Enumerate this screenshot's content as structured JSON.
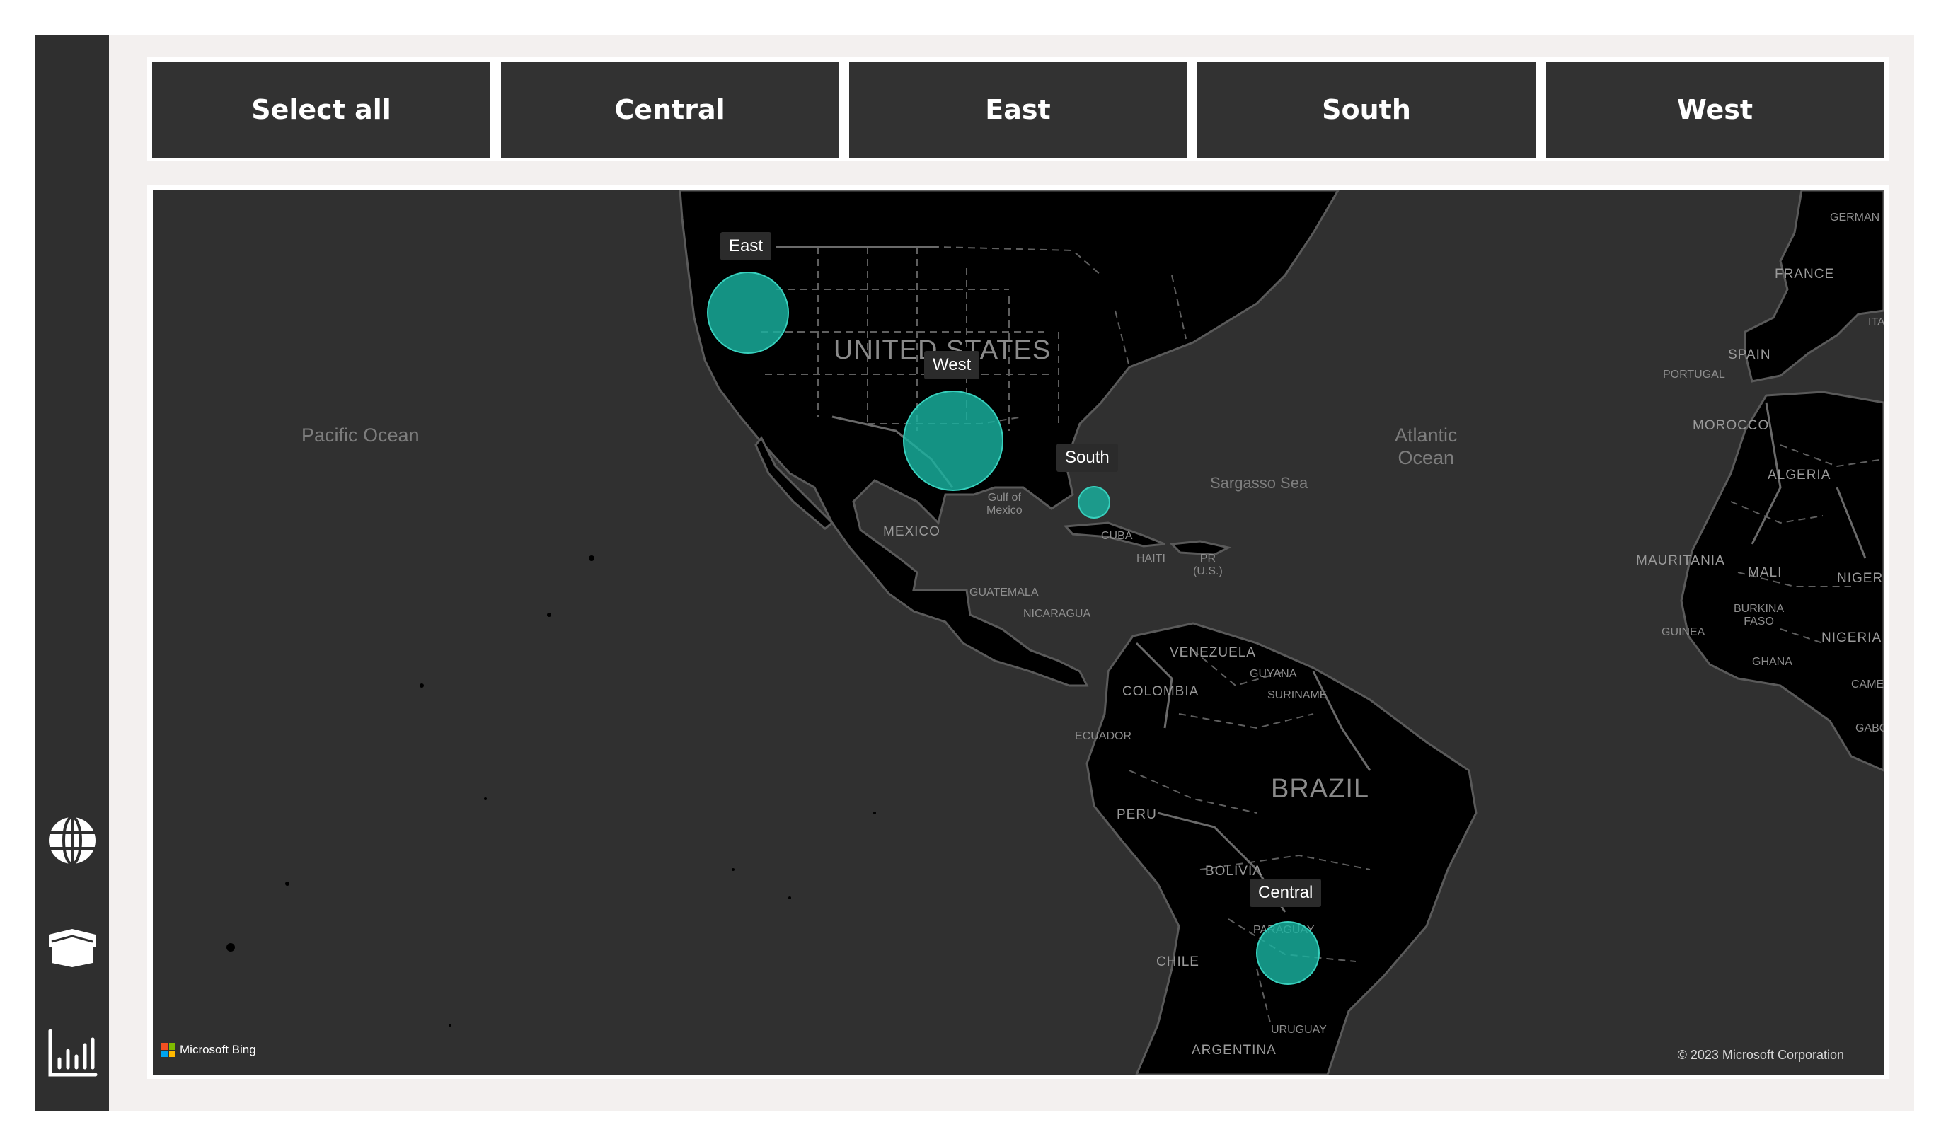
{
  "nav": {
    "items": [
      {
        "icon": "globe-icon"
      },
      {
        "icon": "box-icon"
      },
      {
        "icon": "bar-chart-icon"
      }
    ]
  },
  "slicer": {
    "buttons": [
      "Select all",
      "Central",
      "East",
      "South",
      "West"
    ]
  },
  "map": {
    "oceans": {
      "pacific": "Pacific Ocean",
      "atlantic_line1": "Atlantic",
      "atlantic_line2": "Ocean",
      "sargasso": "Sargasso Sea",
      "gulf_line1": "Gulf of",
      "gulf_line2": "Mexico"
    },
    "countries": {
      "us": "UNITED STATES",
      "brazil": "BRAZIL",
      "mexico": "MEXICO",
      "cuba": "CUBA",
      "haiti": "HAITI",
      "pr_line1": "PR",
      "pr_line2": "(U.S.)",
      "guatemala": "GUATEMALA",
      "nicaragua": "NICARAGUA",
      "venezuela": "VENEZUELA",
      "colombia": "COLOMBIA",
      "guyana": "GUYANA",
      "suriname": "SURINAME",
      "ecuador": "ECUADOR",
      "peru": "PERU",
      "bolivia": "BOLIVIA",
      "paraguay": "PARAGUAY",
      "chile": "CHILE",
      "uruguay": "URUGUAY",
      "argentina": "ARGENTINA",
      "germany": "GERMAN",
      "france": "FRANCE",
      "italy": "ITA",
      "spain": "SPAIN",
      "portugal": "PORTUGAL",
      "morocco": "MOROCCO",
      "algeria": "ALGERIA",
      "mauritania": "MAURITANIA",
      "mali": "MALI",
      "niger": "NIGER",
      "burkina_line1": "BURKINA",
      "burkina_line2": "FASO",
      "guinea": "GUINEA",
      "ghana": "GHANA",
      "nigeria": "NIGERIA",
      "cameroon": "CAMER",
      "gabon": "GABO"
    },
    "bubbles": [
      {
        "label": "East"
      },
      {
        "label": "West"
      },
      {
        "label": "South"
      },
      {
        "label": "Central"
      }
    ],
    "attribution": "Microsoft Bing",
    "copyright": "© 2023 Microsoft Corporation"
  },
  "colors": {
    "bubble": "#18b2a0",
    "land": "#000000",
    "water": "#303030",
    "slicer_bg": "#323232"
  }
}
